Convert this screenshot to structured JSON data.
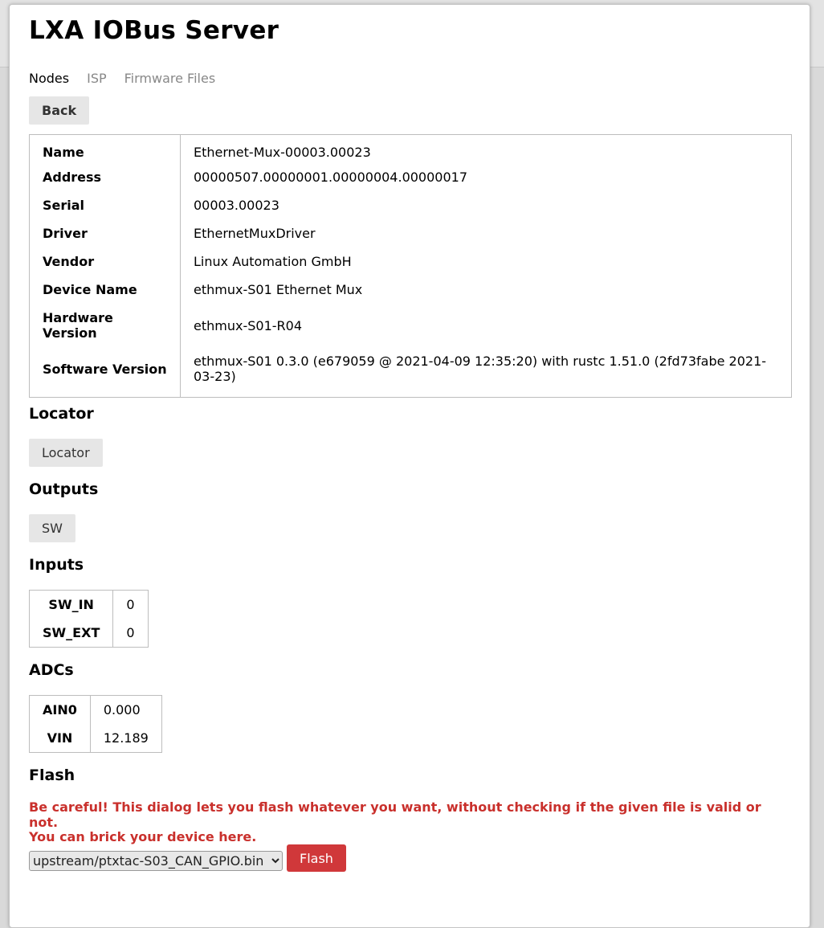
{
  "page": {
    "title": "LXA IOBus Server"
  },
  "tabs": [
    {
      "label": "Nodes",
      "active": true
    },
    {
      "label": "ISP",
      "active": false
    },
    {
      "label": "Firmware Files",
      "active": false
    }
  ],
  "back_label": "Back",
  "info": [
    {
      "key": "Name",
      "value": "Ethernet-Mux-00003.00023"
    },
    {
      "key": "Address",
      "value": "00000507.00000001.00000004.00000017"
    },
    {
      "key": "Serial",
      "value": "00003.00023"
    },
    {
      "key": "Driver",
      "value": "EthernetMuxDriver"
    },
    {
      "key": "Vendor",
      "value": "Linux Automation GmbH"
    },
    {
      "key": "Device Name",
      "value": "ethmux-S01 Ethernet Mux"
    },
    {
      "key": "Hardware Version",
      "value": "ethmux-S01-R04"
    },
    {
      "key": "Software Version",
      "value": "ethmux-S01 0.3.0 (e679059 @ 2021-04-09 12:35:20) with rustc 1.51.0 (2fd73fabe 2021-03-23)"
    }
  ],
  "locator": {
    "heading": "Locator",
    "button": "Locator"
  },
  "outputs": {
    "heading": "Outputs",
    "button": "SW"
  },
  "inputs": {
    "heading": "Inputs",
    "rows": [
      {
        "key": "SW_IN",
        "value": "0"
      },
      {
        "key": "SW_EXT",
        "value": "0"
      }
    ]
  },
  "adcs": {
    "heading": "ADCs",
    "rows": [
      {
        "key": "AIN0",
        "value": "0.000"
      },
      {
        "key": "VIN",
        "value": "12.189"
      }
    ]
  },
  "flash": {
    "heading": "Flash",
    "warning_line1": "Be careful! This dialog lets you flash whatever you want, without checking if the given file is valid or not.",
    "warning_line2": "You can brick your device here.",
    "selected_file": "upstream/ptxtac-S03_CAN_GPIO.bin",
    "button": "Flash"
  },
  "colors": {
    "warning": "#c9302c",
    "flash_button": "#d0383a"
  }
}
